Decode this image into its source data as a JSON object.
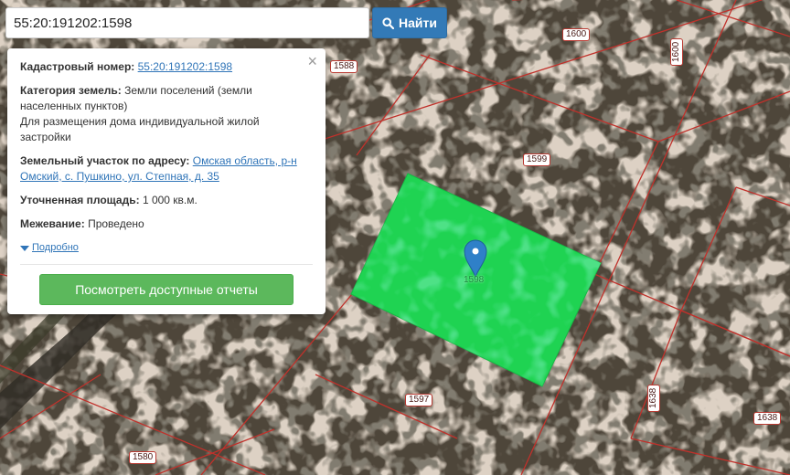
{
  "search": {
    "query": "55:20:191202:1598",
    "button_label": "Найти"
  },
  "popup": {
    "cadastral_label": "Кадастровый номер:",
    "cadastral_value": "55:20:191202:1598",
    "category_label": "Категория земель:",
    "category_value": "Земли поселений (земли населенных пунктов)",
    "purpose": "Для размещения дома индивидуальной жилой застройки",
    "address_label": "Земельный участок по адресу:",
    "address_value": "Омская область, р-н Омский, с. Пушкино, ул. Степная, д. 35",
    "area_label": "Уточненная площадь:",
    "area_value": "1 000 кв.м.",
    "survey_label": "Межевание:",
    "survey_value": "Проведено",
    "details_link": "Подробно",
    "report_button": "Посмотреть доступные отчеты",
    "close_symbol": "×"
  },
  "map": {
    "plot_labels": [
      "1588",
      "1600",
      "1600",
      "1599",
      "1597",
      "1638",
      "1638",
      "1580"
    ],
    "selected_plot_label": "1598",
    "colors": {
      "selected_fill": "#1fd352",
      "boundary": "#c0312b",
      "marker": "#2f80c8",
      "terrain_dark": "#4a4236",
      "terrain_light": "#b8a48c"
    }
  }
}
